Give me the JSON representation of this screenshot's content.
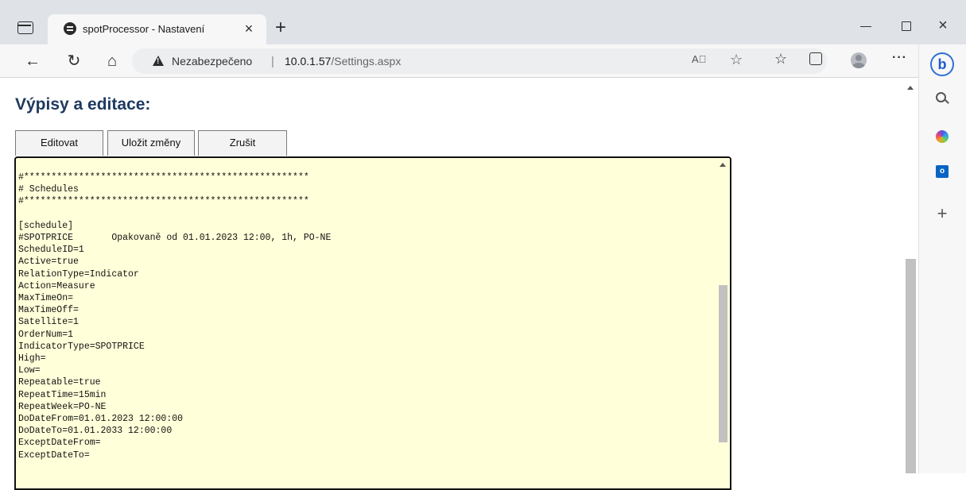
{
  "browser": {
    "tab_title": "spotProcessor - Nastavení",
    "tab_close": "×",
    "new_tab": "+",
    "address": {
      "security_text": "Nezabezpečeno",
      "separator": "|",
      "host": "10.0.1.57",
      "path": "/Settings.aspx"
    },
    "nav": {
      "back": "←",
      "refresh": "↻",
      "home": "⌂"
    },
    "read_aloud": "A⃝",
    "more": "···",
    "window": {
      "close": "×"
    },
    "sidebar": {
      "bing": "b",
      "outlook": "o",
      "add": "+"
    }
  },
  "page": {
    "title": "Výpisy a editace:",
    "buttons": {
      "edit": "Editovat",
      "save": "Uložit změny",
      "cancel": "Zrušit"
    },
    "editor_lines": [
      "#****************************************************",
      "# Schedules",
      "#****************************************************",
      "",
      "[schedule]",
      "#SPOTPRICE       Opakovaně od 01.01.2023 12:00, 1h, PO-NE",
      "ScheduleID=1",
      "Active=true",
      "RelationType=Indicator",
      "Action=Measure",
      "MaxTimeOn=",
      "MaxTimeOff=",
      "Satellite=1",
      "OrderNum=1",
      "IndicatorType=SPOTPRICE",
      "High=",
      "Low=",
      "Repeatable=true",
      "RepeatTime=15min",
      "RepeatWeek=PO-NE",
      "DoDateFrom=01.01.2023 12:00:00",
      "DoDateTo=01.01.2033 12:00:00",
      "ExceptDateFrom=",
      "ExceptDateTo="
    ]
  },
  "colors": {
    "title": "#1f3a60",
    "editor_background": "#ffffd9",
    "bing": "#1e5bd1"
  }
}
